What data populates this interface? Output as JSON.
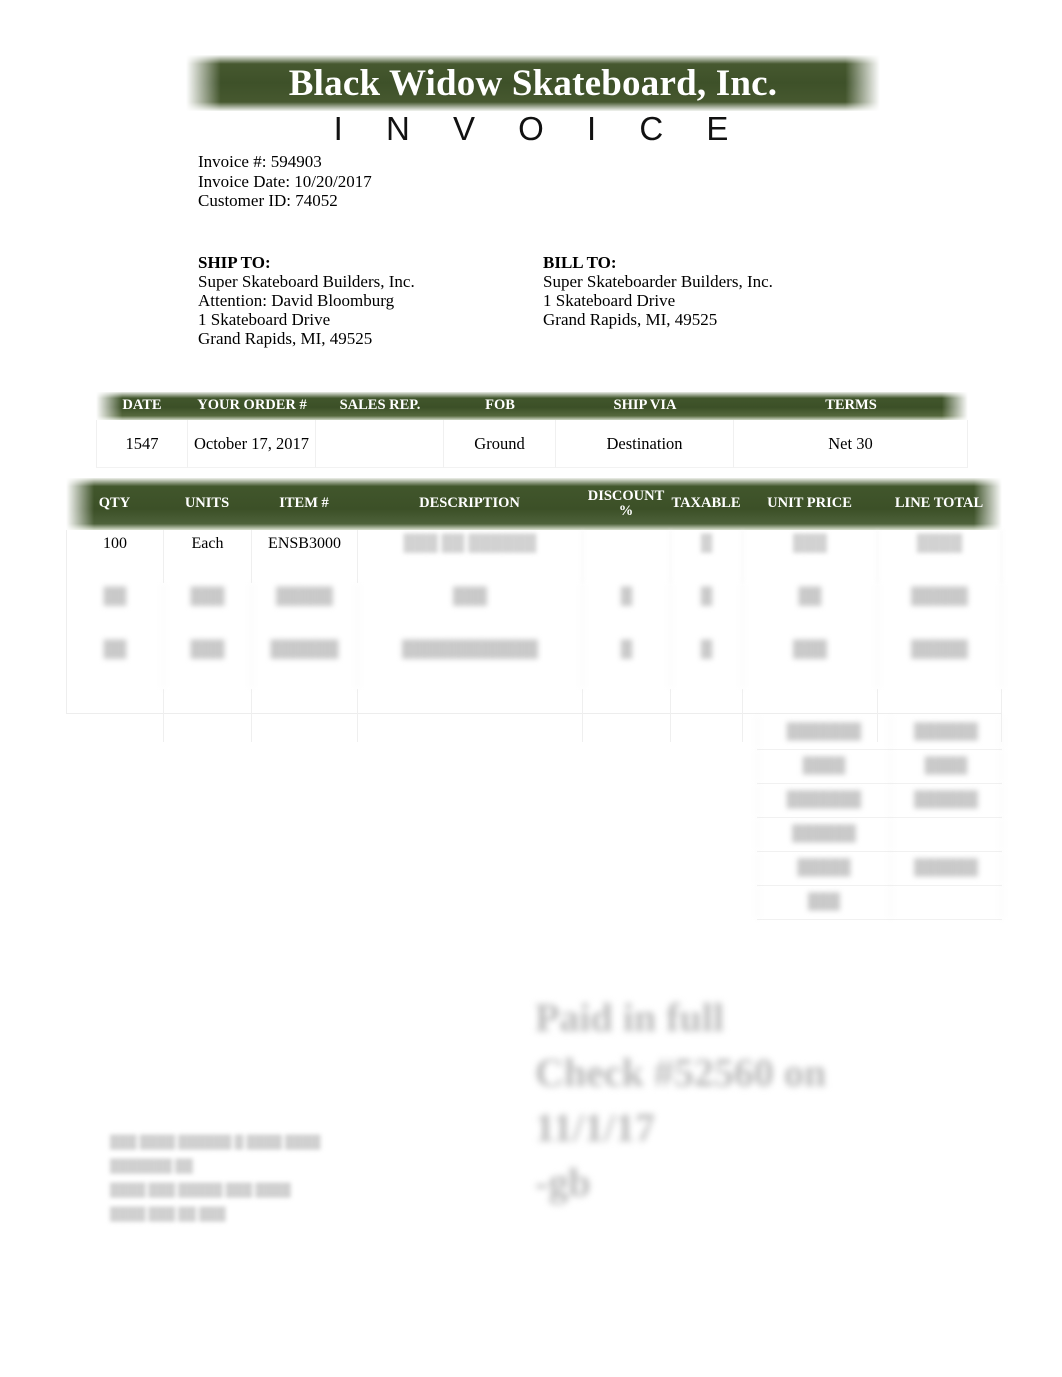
{
  "document": {
    "type": "invoice",
    "company_name": "Black Widow Skateboard, Inc.",
    "title": "I N V O I C E",
    "accent_color": "#3c5027",
    "banner_text_color": "#ffffff"
  },
  "meta": {
    "invoice_number_line": "Invoice #: 594903",
    "invoice_date_line": "Invoice Date: 10/20/2017",
    "customer_id_line": "Customer ID: 74052"
  },
  "ship_to": {
    "heading": "SHIP TO:",
    "lines": [
      "Super Skateboard Builders, Inc.",
      "Attention: David Bloomburg",
      "1 Skateboard Drive",
      "Grand Rapids, MI, 49525"
    ]
  },
  "bill_to": {
    "heading": "BILL TO:",
    "lines": [
      "Super Skateboarder Builders, Inc.",
      "1 Skateboard Drive",
      "Grand Rapids, MI, 49525"
    ]
  },
  "info_table": {
    "headers": [
      "DATE",
      "YOUR ORDER #",
      "SALES REP.",
      "FOB",
      "SHIP VIA",
      "TERMS"
    ],
    "values": [
      "1547",
      "October 17, 2017",
      "",
      "Ground",
      "Destination",
      "Net 30"
    ]
  },
  "items_table": {
    "headers": [
      "QTY",
      "UNITS",
      "ITEM #",
      "DESCRIPTION",
      "DISCOUNT %",
      "TAXABLE",
      "UNIT PRICE",
      "LINE TOTAL"
    ],
    "rows": [
      {
        "qty": "100",
        "units": "Each",
        "item": "ENSB3000",
        "description": "███ ██ ██████",
        "discount": "",
        "taxable": "█",
        "unit_price": "███",
        "line_total": "████",
        "redacted": false
      },
      {
        "qty": "██",
        "units": "███",
        "item": "█████",
        "description": "███",
        "discount": "█",
        "taxable": "█",
        "unit_price": "██",
        "line_total": "█████",
        "redacted": true
      },
      {
        "qty": "██",
        "units": "███",
        "item": "██████",
        "description": "████████████",
        "discount": "█",
        "taxable": "█",
        "unit_price": "███",
        "line_total": "█████",
        "redacted": true
      }
    ]
  },
  "totals": {
    "rows": [
      {
        "label": "███████",
        "value": "██████"
      },
      {
        "label": "████",
        "value": "████"
      },
      {
        "label": "███████",
        "value": "██████"
      },
      {
        "label": "██████",
        "value": ""
      },
      {
        "label": "█████",
        "value": "██████"
      },
      {
        "label": "███",
        "value": ""
      }
    ]
  },
  "annotation": {
    "lines": [
      "Paid in full",
      "Check #52560 on",
      "11/1/17",
      "-gb"
    ]
  },
  "footer_note": {
    "lines": [
      "███ ████ ██████ █ ████ ████",
      "███████ ██",
      "████ ███ █████ ███ ████",
      "████ ███ ██ ███"
    ]
  }
}
